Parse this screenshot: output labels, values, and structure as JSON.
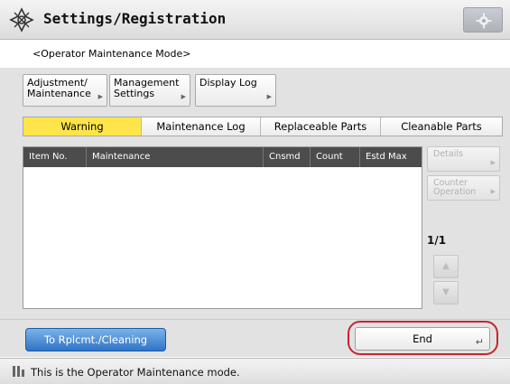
{
  "header": {
    "title": "Settings/Registration",
    "logo_icon": "settings-wheel-icon",
    "settings_button_icon": "gear-icon"
  },
  "mode": {
    "label": "<Operator Maintenance Mode>"
  },
  "top_buttons": [
    {
      "line1": "Adjustment/",
      "line2": "Maintenance"
    },
    {
      "line1": "Management",
      "line2": "Settings"
    },
    {
      "line1": "Display Log",
      "line2": ""
    }
  ],
  "tabs": [
    {
      "label": "Warning",
      "active": true
    },
    {
      "label": "Maintenance Log",
      "active": false
    },
    {
      "label": "Replaceable Parts",
      "active": false
    },
    {
      "label": "Cleanable Parts",
      "active": false
    }
  ],
  "table": {
    "columns": [
      "Item No.",
      "Maintenance",
      "Cnsmd",
      "Count",
      "Estd Max"
    ],
    "rows": []
  },
  "side": {
    "details_label": "Details",
    "counter_line1": "Counter",
    "counter_line2": "Operation",
    "page_indicator": "1/1",
    "up_icon": "up-arrow-icon",
    "down_icon": "down-arrow-icon"
  },
  "bottom": {
    "replacement_button": "To Rplcmt./Cleaning",
    "end_button": "End",
    "enter_icon": "enter-key-icon"
  },
  "status": {
    "message": "This is the Operator Maintenance mode.",
    "icon": "wrench-icon"
  },
  "colors": {
    "active_tab": "#ffe44a",
    "primary_button": "#2f74c7",
    "highlight_ring": "#c5252f",
    "table_header": "#4c4c4c"
  }
}
